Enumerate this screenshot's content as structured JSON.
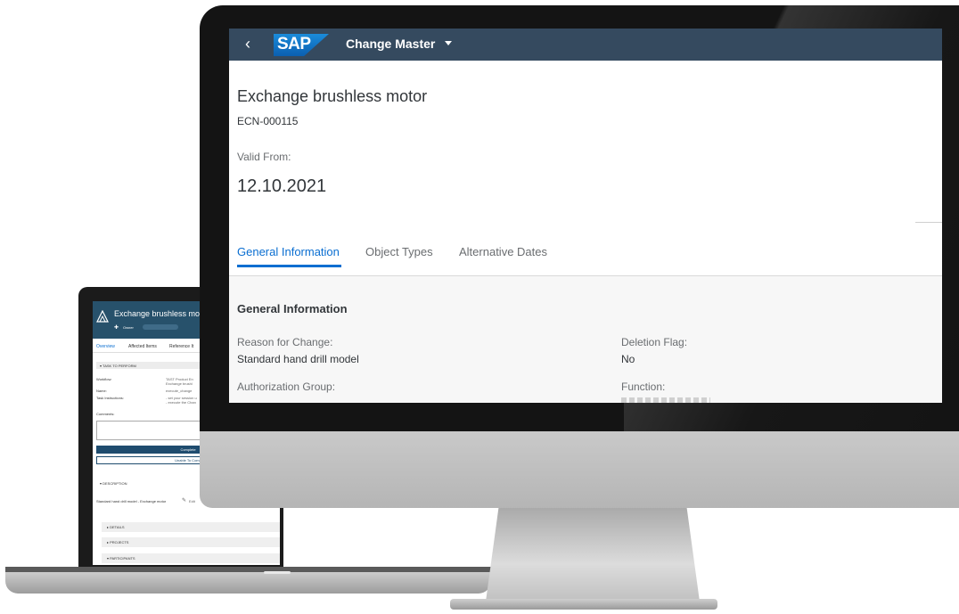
{
  "laptop": {
    "app_title": "Exchange brushless motor",
    "header_sub_left": "Owner",
    "header_sub_right": "Due Week",
    "tabs": [
      "Overview",
      "Affected Items",
      "Reference It"
    ],
    "task_section": "TASK TO PERFORM",
    "workflow_label": "Workflow:",
    "workflow_value_1": "TAST Product En",
    "workflow_value_2": "Exchange brushl",
    "name_label": "Name:",
    "name_value": "execute_change",
    "instructions_label": "Task Instructions:",
    "instructions_value_1": "- set your session u",
    "instructions_value_2": "- execute the Chan",
    "comments_label": "Comments:",
    "complete_button": "Complete",
    "unable_button": "Unable To Comp",
    "description_section": "DESCRIPTION",
    "description_text": "Standard hand drill model - Exchange motor",
    "edit_label": "Edit",
    "details_section": "DETAILS",
    "projects_section": "PROJECTS",
    "participants_section": "PARTICIPANTS"
  },
  "shell": {
    "back_icon": "chevron-left-icon",
    "logo_text": "SAP",
    "app_title": "Change Master"
  },
  "object": {
    "title": "Exchange brushless motor",
    "number": "ECN-000115",
    "valid_from_label": "Valid From:",
    "valid_from_value": "12.10.2021"
  },
  "tabs": [
    {
      "label": "General Information",
      "active": true
    },
    {
      "label": "Object Types",
      "active": false
    },
    {
      "label": "Alternative Dates",
      "active": false
    }
  ],
  "general": {
    "section_title": "General Information",
    "reason_label": "Reason for Change:",
    "reason_value": "Standard hand drill model",
    "deletion_label": "Deletion Flag:",
    "deletion_value": "No",
    "auth_label": "Authorization Group:",
    "function_label": "Function:"
  },
  "colors": {
    "shell": "#354a5f",
    "accent": "#0a6ed1",
    "laptop_header": "#27516b"
  }
}
